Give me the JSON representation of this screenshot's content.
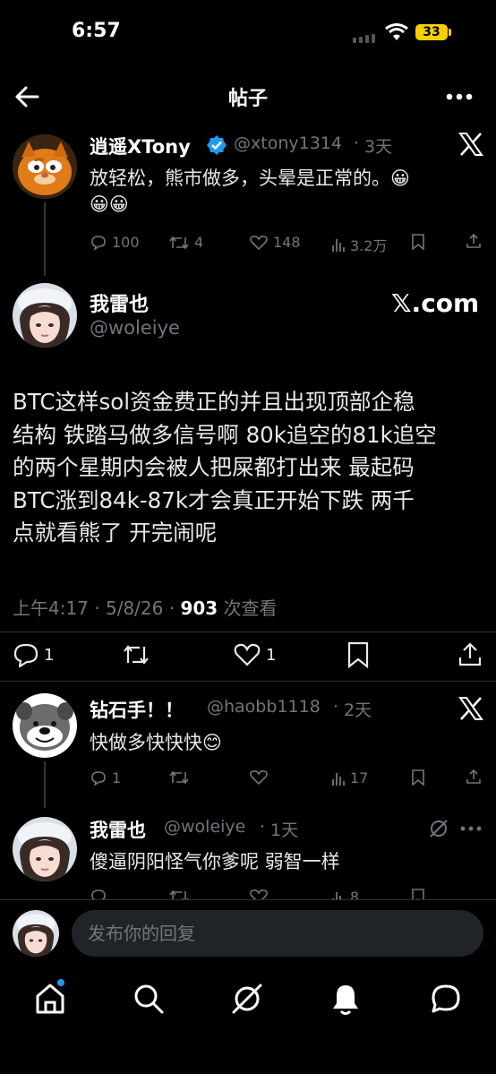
{
  "status_bar": {
    "time": "6:57",
    "battery": "33"
  },
  "header": {
    "title": "帖子"
  },
  "quoted_post": {
    "display_name": "逍遥XTony",
    "handle": "@xtony1314",
    "age": "3天",
    "text_line1": "放轻松，熊市做多，头晕是正常的。😀",
    "text_line2": "😀😀",
    "stats": {
      "replies": "100",
      "reposts": "4",
      "likes": "148",
      "views": "3.2万"
    }
  },
  "main_post": {
    "display_name": "我雷也",
    "handle": "@woleiye",
    "source_label": "𝕏.com",
    "text_lines": [
      "BTC这样sol资金费正的并且出现顶部企稳",
      "结构 铁踏马做多信号啊 80k追空的81k追空",
      "的两个星期内会被人把屎都打出来 最起码",
      "BTC涨到84k-87k才会真正开始下跌 两千",
      "点就看熊了 开完闹呢"
    ],
    "meta_time": "上午4:17 · 5/8/26 · ",
    "meta_views": "903",
    "meta_views_label": " 次查看",
    "stats": {
      "replies": "1",
      "likes": "1"
    }
  },
  "reply_1": {
    "display_name": "钻石手！！",
    "handle": "@haobb1118",
    "age": "2天",
    "text": "快做多快快快😊",
    "stats": {
      "replies": "1",
      "views": "17"
    }
  },
  "reply_2": {
    "display_name": "我雷也",
    "handle": "@woleiye",
    "age": "1天",
    "text": "傻逼阴阳怪气你爹呢 弱智一样",
    "stats": {
      "views": "8"
    }
  },
  "composer": {
    "placeholder": "发布你的回复"
  },
  "icons": [
    "back-arrow-icon",
    "more-icon",
    "x-logo-icon",
    "verified-badge-icon",
    "reply-icon",
    "repost-icon",
    "like-icon",
    "views-icon",
    "bookmark-icon",
    "share-icon",
    "home-icon",
    "search-icon",
    "grok-icon",
    "notifications-icon",
    "messages-icon"
  ],
  "colors": {
    "background": "#000000",
    "text": "#e7e9ea",
    "muted": "#71767b",
    "verified": "#1d9bf0",
    "divider": "#2f3336",
    "notification_dot": "#1d9bf0"
  }
}
